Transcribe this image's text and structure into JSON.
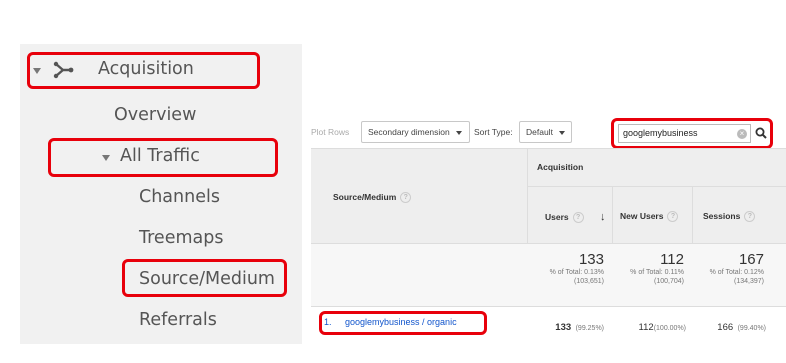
{
  "nav": {
    "acquisition_label": "Acquisition",
    "overview_label": "Overview",
    "all_traffic_label": "All Traffic",
    "channels_label": "Channels",
    "treemaps_label": "Treemaps",
    "source_medium_label": "Source/Medium",
    "referrals_label": "Referrals"
  },
  "toolbar": {
    "plot_rows_label": "Plot Rows",
    "secondary_dimension_label": "Secondary dimension",
    "sort_type_label": "Sort Type:",
    "sort_type_value": "Default",
    "search_value": "googlemybusiness"
  },
  "table": {
    "dimension_header": "Source/Medium",
    "group_header": "Acquisition",
    "columns": {
      "users": "Users",
      "new_users": "New Users",
      "sessions": "Sessions"
    },
    "totals": {
      "users": "133",
      "users_pct": "% of Total: 0.13%",
      "users_base": "(103,651)",
      "new_users": "112",
      "new_users_pct": "% of Total: 0.11%",
      "new_users_base": "(100,704)",
      "sessions": "167",
      "sessions_pct": "% of Total: 0.12%",
      "sessions_base": "(134,397)"
    },
    "rows": [
      {
        "index": "1.",
        "source": "googlemybusiness / organic",
        "users": "133",
        "users_share": "(99.25%)",
        "new_users": "112",
        "new_users_share": "(100.00%)",
        "sessions": "166",
        "sessions_share": "(99.40%)"
      }
    ]
  },
  "colors": {
    "highlight": "#e8000b",
    "link": "#1155cc",
    "nav_background": "#f1f1f1",
    "header_background": "#eeeeee"
  }
}
